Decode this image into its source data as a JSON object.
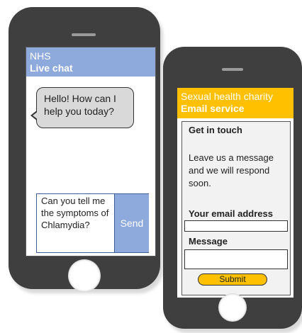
{
  "phone_chat": {
    "org": "NHS",
    "service": "Live chat",
    "bot_message": "Hello! How can I help you today?",
    "user_message": "Can you tell me the symptoms of Chlamydia?",
    "send_label": "Send"
  },
  "phone_email": {
    "org": "Sexual health charity",
    "service": "Email service",
    "form_title": "Get in touch",
    "form_description": "Leave us a message and we will respond soon.",
    "email_label": "Your email address",
    "message_label": "Message",
    "submit_label": "Submit"
  },
  "colors": {
    "chat_header": "#8ea9db",
    "email_header": "#ffc000",
    "phone_body": "#3f3f3f"
  }
}
